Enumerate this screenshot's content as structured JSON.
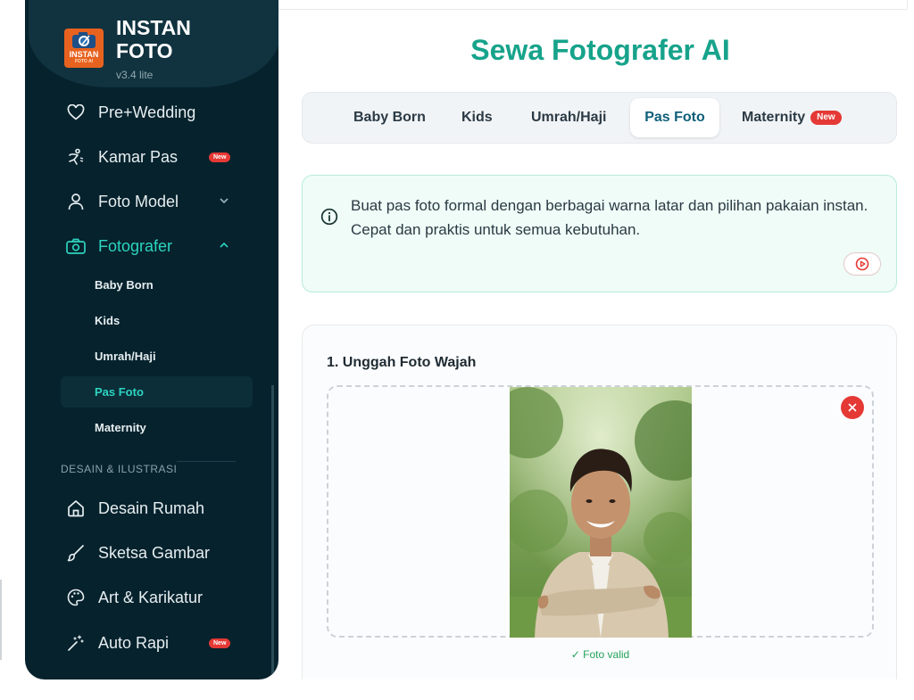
{
  "brand": {
    "name": "INSTAN FOTO",
    "version": "v3.4 lite",
    "badge_line1": "INSTAN",
    "badge_line2": "FOTO AI"
  },
  "sidebar": {
    "nav": [
      {
        "label": "Pre+Wedding",
        "icon": "heart-icon"
      },
      {
        "label": "Kamar Pas",
        "icon": "person-icon",
        "badge": "New"
      },
      {
        "label": "Foto Model",
        "icon": "user-icon"
      },
      {
        "label": "Fotografer",
        "icon": "camera-icon",
        "active": true
      }
    ],
    "sub_items": [
      "Baby Born",
      "Kids",
      "Umrah/Haji",
      "Pas Foto",
      "Maternity"
    ],
    "active_sub": "Pas Foto",
    "section_label": "DESAIN & ILUSTRASI",
    "section_items": [
      {
        "label": "Desain Rumah",
        "icon": "home-icon"
      },
      {
        "label": "Sketsa Gambar",
        "icon": "brush-icon"
      },
      {
        "label": "Art & Karikatur",
        "icon": "palette-icon"
      },
      {
        "label": "Auto Rapi",
        "icon": "magic-wand-icon",
        "badge": "New"
      }
    ]
  },
  "main": {
    "title": "Sewa Fotografer AI",
    "tabs": [
      {
        "label": "Baby Born"
      },
      {
        "label": "Kids"
      },
      {
        "label": "Umrah/Haji"
      },
      {
        "label": "Pas Foto",
        "active": true
      },
      {
        "label": "Maternity",
        "badge": "New"
      }
    ],
    "info_text": "Buat pas foto formal dengan berbagai warna latar dan pilihan pakaian instan. Cepat dan praktis untuk semua kebutuhan.",
    "upload_title": "1. Unggah Foto Wajah",
    "upload_status": "✓ Foto valid"
  },
  "colors": {
    "sidebar_bg": "#06222d",
    "accent": "#17a38b",
    "active_nav": "#2dd4bf",
    "new_badge": "#e53935",
    "info_bg": "#effcf7"
  }
}
